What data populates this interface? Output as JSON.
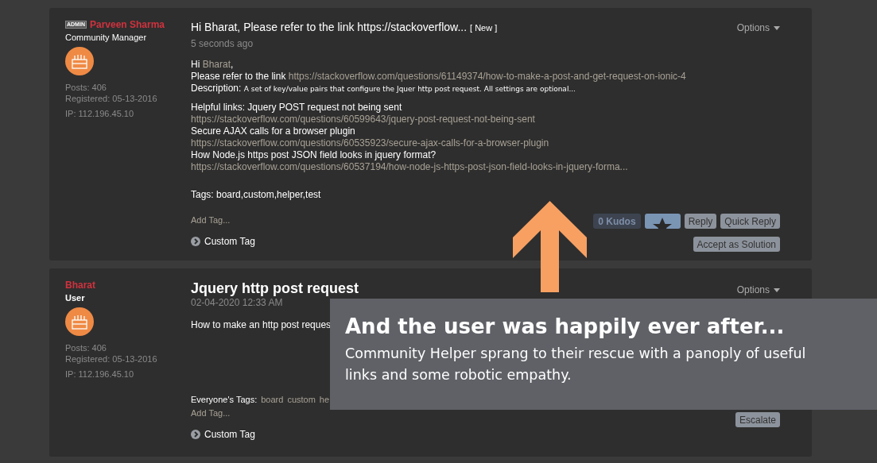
{
  "posts": [
    {
      "author": {
        "badge": "ADMIN",
        "name": "Parveen Sharma",
        "role": "Community Manager",
        "posts": "Posts: 406",
        "registered": "Registered: 05-13-2016",
        "ip": "IP: 112.196.45.10"
      },
      "title": "Hi Bharat, Please refer to the link https://stackoverflow...",
      "new_label": "[ New ]",
      "time": "5 seconds ago",
      "options": "Options",
      "body": [
        {
          "kind": "greeting",
          "text": "Hi ",
          "link": "Bharat",
          "tail": ","
        },
        {
          "kind": "linkline",
          "text": "Please refer to the link ",
          "link": "https://stackoverflow.com/questions/61149374/how-to-make-a-post-and-get-request-on-ionic-4"
        },
        {
          "kind": "description",
          "text": "Description: ",
          "small": "A set of key/value pairs that configure the Jquer http post request. All settings are optional..."
        },
        {
          "kind": "gap"
        },
        {
          "kind": "text",
          "text": "Helpful links: Jquery POST request not being sent"
        },
        {
          "kind": "url",
          "link": "https://stackoverflow.com/questions/60599643/jquery-post-request-not-being-sent"
        },
        {
          "kind": "text",
          "text": "Secure AJAX calls for a browser plugin"
        },
        {
          "kind": "url",
          "link": "https://stackoverflow.com/questions/60535923/secure-ajax-calls-for-a-browser-plugin"
        },
        {
          "kind": "text",
          "text": "How Node.js https post JSON field looks in jquery format?"
        },
        {
          "kind": "url",
          "link": "https://stackoverflow.com/questions/60537194/how-node-js-https-post-json-field-looks-in-jquery-forma..."
        },
        {
          "kind": "bigGap"
        },
        {
          "kind": "text",
          "text": "Tags: board,custom,helper,test"
        }
      ],
      "add_tag": "Add Tag...",
      "custom_tag": "Custom Tag",
      "actions": [
        {
          "kind": "kudos",
          "label": "0 Kudos"
        },
        {
          "kind": "star"
        },
        {
          "kind": "button",
          "label": "Reply"
        },
        {
          "kind": "button",
          "label": "Quick Reply"
        },
        {
          "kind": "break"
        },
        {
          "kind": "button",
          "label": "Accept as Solution"
        }
      ]
    },
    {
      "author": {
        "name": "Bharat",
        "role": "User",
        "posts": "Posts: 406",
        "registered": "Registered: 05-13-2016",
        "ip": "IP: 112.196.45.10"
      },
      "title": "Jquery http post request",
      "time": "02-04-2020 12:33 AM",
      "options": "Options",
      "body": [
        {
          "kind": "text",
          "text": "How to make an http post reques"
        }
      ],
      "everyone_tags": {
        "label": "Everyone's Tags:",
        "tags": [
          "board",
          "custom",
          "he"
        ]
      },
      "add_tag": "Add Tag...",
      "custom_tag": "Custom Tag",
      "actions": [
        {
          "kind": "button",
          "label": "Escalate"
        }
      ]
    }
  ],
  "callout": {
    "heading": "And the user was happily ever after...",
    "text": "Community Helper sprang to their rescue with a panoply of useful links and some robotic empathy."
  }
}
